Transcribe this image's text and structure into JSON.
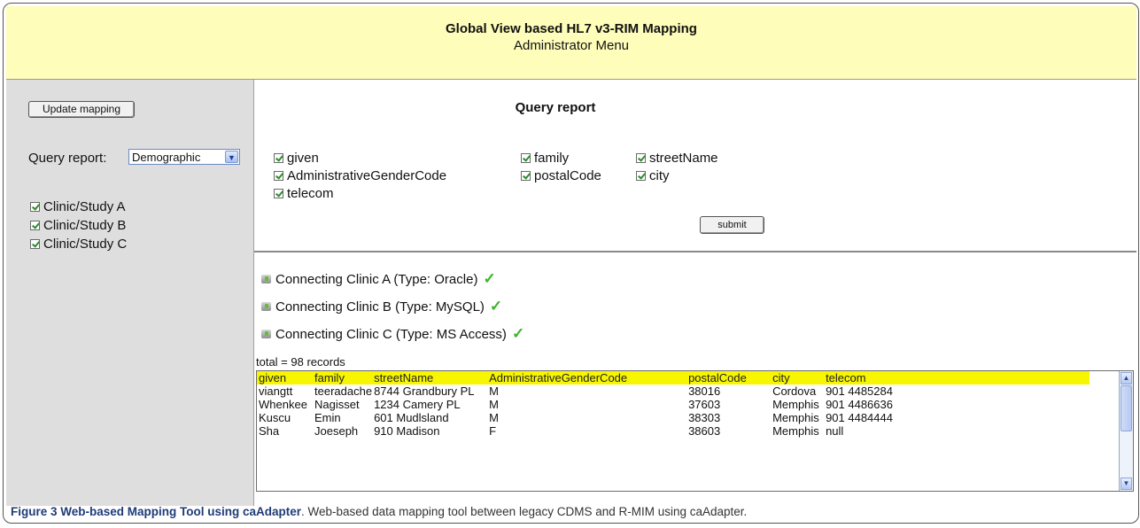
{
  "header": {
    "title": "Global View based HL7 v3-RIM Mapping",
    "subtitle": "Administrator Menu"
  },
  "sidebar": {
    "update_button": "Update mapping",
    "query_label": "Query report:",
    "query_select_value": "Demographic",
    "clinics": [
      "Clinic/Study A",
      "Clinic/Study B",
      "Clinic/Study C"
    ]
  },
  "query": {
    "title": "Query report",
    "fields": [
      "given",
      "family",
      "streetName",
      "AdministrativeGenderCode",
      "postalCode",
      "city",
      "telecom"
    ],
    "submit_label": "submit"
  },
  "connections": [
    "Connecting Clinic A (Type: Oracle)",
    "Connecting Clinic B (Type: MySQL)",
    "Connecting Clinic C (Type: MS Access)"
  ],
  "results": {
    "total_label": "total = 98 records",
    "columns": [
      "given",
      "family",
      "streetName",
      "AdministrativeGenderCode",
      "postalCode",
      "city",
      "telecom"
    ],
    "rows": [
      [
        "viangtt",
        "teeradache",
        "8744 Grandbury PL",
        "M",
        "38016",
        "Cordova",
        "901 4485284"
      ],
      [
        "Whenkee",
        "Nagisset",
        "1234 Camery PL",
        "M",
        "37603",
        "Memphis",
        "901 4486636"
      ],
      [
        "Kuscu",
        "Emin",
        "601 Mudlsland",
        "M",
        "38303",
        "Memphis",
        "901 4484444"
      ],
      [
        "Sha",
        "Joeseph",
        "910 Madison",
        "F",
        "38603",
        "Memphis",
        "null"
      ]
    ]
  },
  "caption": {
    "bold": "Figure 3 Web-based Mapping Tool using caAdapter",
    "rest": ". Web-based data mapping tool between legacy CDMS and R-MIM using caAdapter."
  }
}
